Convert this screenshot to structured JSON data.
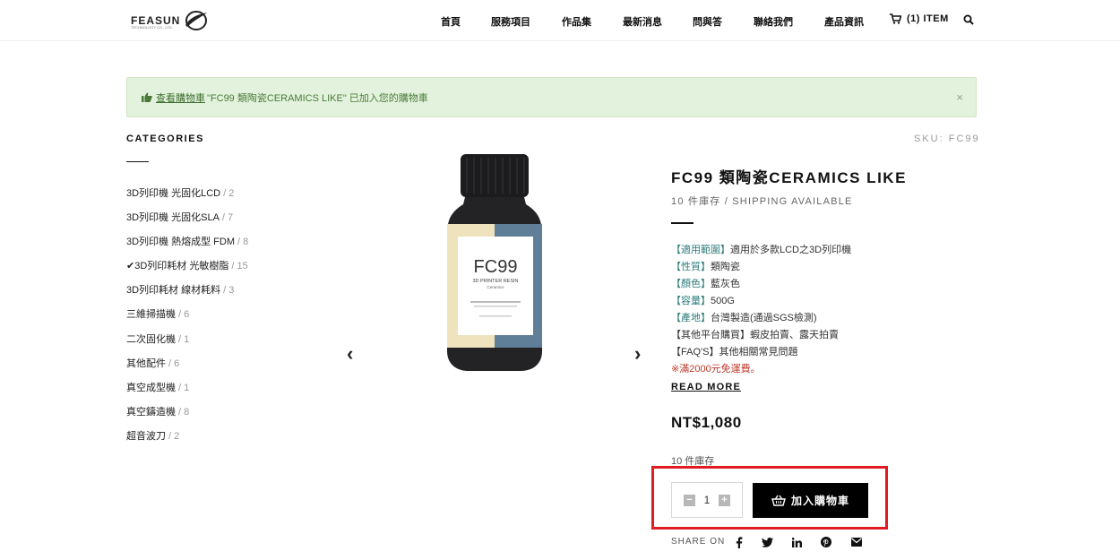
{
  "brand": {
    "name": "FEASUN",
    "tagline": "TECHNOLOGY CO., LTD."
  },
  "nav": {
    "items": [
      "首頁",
      "服務項目",
      "作品集",
      "最新消息",
      "問與答",
      "聯絡我們",
      "產品資訊"
    ]
  },
  "cart": {
    "label": "(1) ITEM"
  },
  "notice": {
    "link": "查看購物車",
    "message": "\"FC99 類陶瓷CERAMICS LIKE\" 已加入您的購物車",
    "close": "×"
  },
  "sidebar": {
    "title": "CATEGORIES",
    "categories": [
      {
        "label": "3D列印機 光固化LCD",
        "count": "/ 2"
      },
      {
        "label": "3D列印機 光固化SLA",
        "count": "/ 7"
      },
      {
        "label": "3D列印機 熱熔成型 FDM",
        "count": "/ 8"
      },
      {
        "label": "✔3D列印耗材 光敏樹脂",
        "count": "/ 15"
      },
      {
        "label": "3D列印耗材 線材耗料",
        "count": "/ 3"
      },
      {
        "label": "三維掃描機",
        "count": "/ 6"
      },
      {
        "label": "二次固化機",
        "count": "/ 1"
      },
      {
        "label": "其他配件",
        "count": "/ 6"
      },
      {
        "label": "真空成型機",
        "count": "/ 1"
      },
      {
        "label": "真空鑄造機",
        "count": "/ 8"
      },
      {
        "label": "超音波刀",
        "count": "/ 2"
      }
    ]
  },
  "product": {
    "sku": "SKU: FC99",
    "title": "FC99 類陶瓷CERAMICS LIKE",
    "stock_line": "10 件庫存 / SHIPPING AVAILABLE",
    "bottle_label": {
      "model": "FC99",
      "line1": "3D PRINTER RESIN",
      "line2": "Ceramics"
    },
    "description": [
      {
        "key": "【適用範圍】",
        "value": "適用於多款LCD之3D列印機"
      },
      {
        "key": "【性質】",
        "value": "類陶瓷"
      },
      {
        "key": "【顏色】",
        "value": "藍灰色"
      },
      {
        "key": "【容量】",
        "value": "500G"
      },
      {
        "key": "【產地】",
        "value": "台灣製造(通過SGS檢測)"
      },
      {
        "key": "",
        "value": "【其他平台購買】蝦皮拍賣、露天拍賣"
      },
      {
        "key": "",
        "value": "【FAQ'S】其他相關常見問題"
      }
    ],
    "promo": "※滿2000元免運費。",
    "read_more": "READ MORE",
    "price": "NT$1,080",
    "stock_count": "10 件庫存",
    "quantity": "1",
    "add_to_cart": "加入購物車",
    "share_label": "SHARE ON"
  },
  "icons": {
    "cart": "cart-icon",
    "search": "search-icon",
    "thumbs_up": "thumbs-up-icon",
    "basket": "basket-icon",
    "facebook": "facebook-icon",
    "twitter": "twitter-icon",
    "linkedin": "linkedin-icon",
    "pinterest": "pinterest-icon",
    "email": "email-icon"
  },
  "colors": {
    "notice_bg": "#e3f2dc",
    "notice_text": "#4a7a3a",
    "highlight": "#e01b24",
    "accent_key": "#2c7c7a",
    "promo": "#c0392b",
    "button_bg": "#000000"
  }
}
